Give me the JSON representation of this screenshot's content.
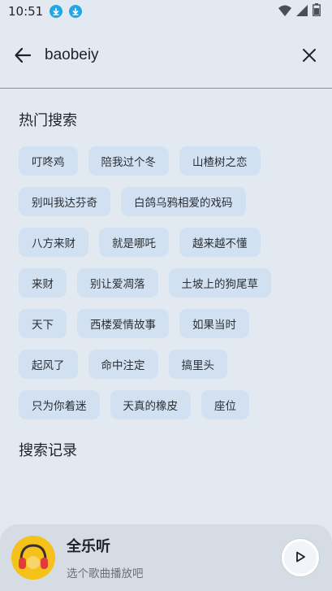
{
  "status_bar": {
    "time": "10:51",
    "icons": [
      "download-icon",
      "download-icon",
      "wifi-icon",
      "signal-icon",
      "battery-icon"
    ]
  },
  "search": {
    "query": "baobeiy",
    "back_icon": "arrow-left-icon",
    "clear_icon": "close-icon"
  },
  "hot_search": {
    "title": "热门搜索",
    "rows": [
      [
        "叮咚鸡",
        "陪我过个冬",
        "山楂树之恋"
      ],
      [
        "别叫我达芬奇",
        "白鸽乌鸦相爱的戏码"
      ],
      [
        "八方来财",
        "就是哪吒",
        "越来越不懂"
      ],
      [
        "来财",
        "别让爱凋落",
        "土坡上的狗尾草"
      ],
      [
        "天下",
        "西楼爱情故事",
        "如果当时"
      ],
      [
        "起风了",
        "命中注定",
        "搞里头"
      ],
      [
        "只为你着迷",
        "天真的橡皮",
        "座位"
      ]
    ]
  },
  "history": {
    "title": "搜索记录"
  },
  "player": {
    "title": "全乐听",
    "subtitle": "选个歌曲播放吧",
    "play_icon": "play-icon"
  },
  "colors": {
    "background": "#e3e9f1",
    "tag_background": "#d2e1f1",
    "accent_download": "#22a6e8",
    "cover_yellow": "#f5c21b"
  }
}
